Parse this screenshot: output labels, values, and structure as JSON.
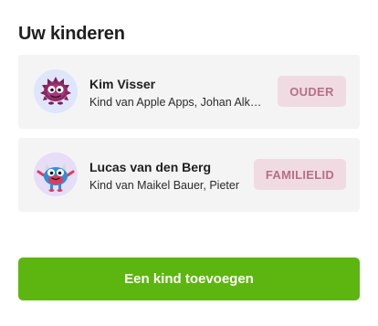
{
  "section": {
    "title": "Uw kinderen"
  },
  "children": [
    {
      "name": "Kim Visser",
      "subtitle": "Kind van Apple Apps, Johan Alkema",
      "role": "OUDER",
      "avatar_icon": "purple-fuzzy-monster-icon"
    },
    {
      "name": "Lucas van den Berg",
      "subtitle": "Kind van Maikel Bauer, Pieter",
      "role": "FAMILIELID",
      "avatar_icon": "blue-horned-monster-icon"
    }
  ],
  "actions": {
    "add_child_label": "Een kind toevoegen"
  },
  "colors": {
    "primary_green": "#5cb60f",
    "badge_bg": "#f1dbe2",
    "badge_text": "#b56f86",
    "card_bg": "#f4f4f5"
  }
}
